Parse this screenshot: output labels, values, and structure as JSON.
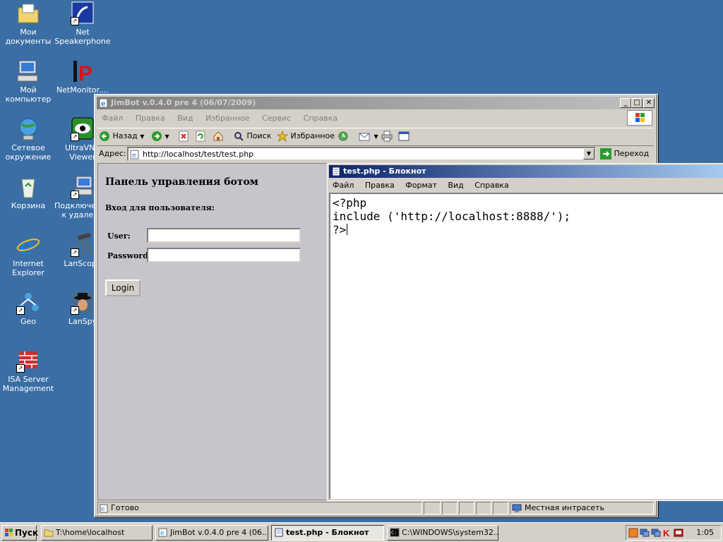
{
  "desktop": {
    "icons": [
      {
        "label": "Мои документы",
        "icon": "folder-documents-icon"
      },
      {
        "label": "Net Speakerphone",
        "icon": "speakerphone-icon"
      },
      {
        "label": "Мой компьютер",
        "icon": "computer-icon"
      },
      {
        "label": "NetMonitor....",
        "icon": "netmonitor-icon"
      },
      {
        "label": "Сетевое окружение",
        "icon": "network-icon"
      },
      {
        "label": "UltraVNC Viewer",
        "icon": "ultravnc-icon"
      },
      {
        "label": "Корзина",
        "icon": "recycle-bin-icon"
      },
      {
        "label": "Подключение к удаленн",
        "icon": "remote-desktop-icon"
      },
      {
        "label": "Internet Explorer",
        "icon": "ie-icon"
      },
      {
        "label": "LanScope",
        "icon": "lanscope-icon"
      },
      {
        "label": "Geo",
        "icon": "geo-icon"
      },
      {
        "label": "LanSpy",
        "icon": "lanspy-icon"
      },
      {
        "label": "ISA Server Management",
        "icon": "isa-server-icon"
      }
    ]
  },
  "browser": {
    "title": "JimBot v.0.4.0 pre 4 (06/07/2009)",
    "menu": [
      "Файл",
      "Правка",
      "Вид",
      "Избранное",
      "Сервис",
      "Справка"
    ],
    "toolbar": {
      "back": "Назад",
      "search": "Поиск",
      "favorites": "Избранное"
    },
    "address_label": "Адрес:",
    "address": "http://localhost/test/test.php",
    "go": "Переход",
    "page": {
      "heading": "Панель управления ботом",
      "subheading": "Вход для пользователя:",
      "user_label": "User:",
      "password_label": "Password:",
      "login_button": "Login"
    },
    "status": "Готово",
    "zone": "Местная интрасеть"
  },
  "notepad": {
    "title": "test.php - Блокнот",
    "menu": [
      "Файл",
      "Правка",
      "Формат",
      "Вид",
      "Справка"
    ],
    "lines": [
      "<?php",
      "include ('http://localhost:8888/');",
      "?>"
    ]
  },
  "taskbar": {
    "start": "Пуск",
    "tasks": [
      {
        "label": "T:\\home\\localhost"
      },
      {
        "label": "JimBot v.0.4.0 pre 4 (06..."
      },
      {
        "label": "test.php - Блокнот"
      },
      {
        "label": "C:\\WINDOWS\\system32..."
      }
    ],
    "clock": "1:05"
  },
  "colors": {
    "desktop": "#3a6ea5",
    "active_title": "#0a246a",
    "face": "#d4d0c8"
  }
}
